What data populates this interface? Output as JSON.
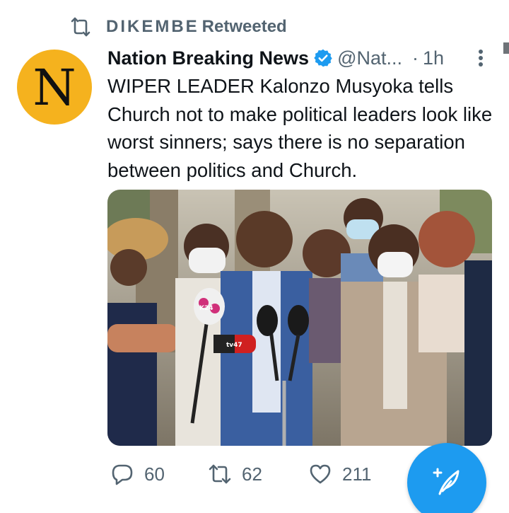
{
  "retweet_banner": {
    "retweeter": "DIKEMBE",
    "suffix": "Retweeted"
  },
  "tweet": {
    "avatar_letter": "N",
    "display_name": "Nation Breaking News",
    "handle": "@Nat...",
    "separator": "·",
    "time": "1h",
    "text": "WIPER LEADER Kalonzo Musyoka tells Church not to make political leaders look like worst sinners; says there is no separation between politics and Church.",
    "media": {
      "microphone_flags": [
        "K24",
        "tv47"
      ]
    }
  },
  "actions": {
    "replies": "60",
    "retweets": "62",
    "likes": "211"
  },
  "icons": {
    "retweet": "retweet-icon",
    "verified": "verified-badge-icon",
    "more": "more-options-icon",
    "reply": "reply-icon",
    "like": "heart-icon",
    "compose": "compose-tweet-icon"
  },
  "colors": {
    "accent": "#1d9bf0",
    "muted": "#536471",
    "avatar_bg": "#f5b21e"
  }
}
